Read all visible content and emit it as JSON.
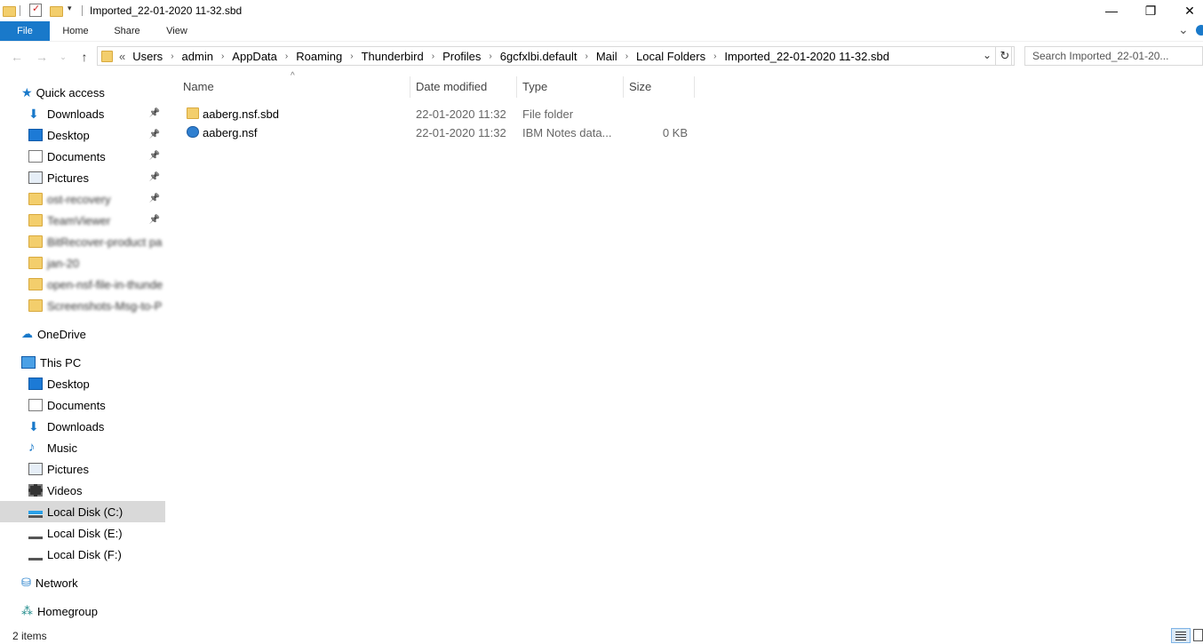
{
  "window": {
    "title": "Imported_22-01-2020 11-32.sbd",
    "minimize_glyph": "—",
    "restore_glyph": "❐",
    "close_glyph": "✕"
  },
  "ribbon": {
    "tabs": [
      "File",
      "Home",
      "Share",
      "View"
    ],
    "expand_glyph": "⌄"
  },
  "address": {
    "overflow": "«",
    "crumbs": [
      "Users",
      "admin",
      "AppData",
      "Roaming",
      "Thunderbird",
      "Profiles",
      "6gcfxlbi.default",
      "Mail",
      "Local Folders",
      "Imported_22-01-2020 11-32.sbd"
    ],
    "separator": "›",
    "search_placeholder": "Search Imported_22-01-20..."
  },
  "nav": {
    "quick_access": "Quick access",
    "quick_items": [
      {
        "label": "Downloads",
        "icon": "download-icon",
        "pinned": true
      },
      {
        "label": "Desktop",
        "icon": "desktop-icon",
        "pinned": true
      },
      {
        "label": "Documents",
        "icon": "documents-icon",
        "pinned": true
      },
      {
        "label": "Pictures",
        "icon": "pictures-icon",
        "pinned": true
      },
      {
        "label": "ost-recovery",
        "icon": "folder-icon",
        "pinned": true,
        "blurred": true
      },
      {
        "label": "TeamViewer",
        "icon": "folder-icon",
        "pinned": true,
        "blurred": true
      },
      {
        "label": "BitRecover-product pa",
        "icon": "folder-icon",
        "pinned": false,
        "blurred": true
      },
      {
        "label": "jan-20",
        "icon": "folder-icon",
        "pinned": false,
        "blurred": true
      },
      {
        "label": "open-nsf-file-in-thunde",
        "icon": "folder-icon",
        "pinned": false,
        "blurred": true
      },
      {
        "label": "Screenshots-Msg-to-P",
        "icon": "folder-icon",
        "pinned": false,
        "blurred": true
      }
    ],
    "onedrive": "OneDrive",
    "this_pc": "This PC",
    "pc_items": [
      {
        "label": "Desktop",
        "icon": "desktop-icon"
      },
      {
        "label": "Documents",
        "icon": "documents-icon"
      },
      {
        "label": "Downloads",
        "icon": "download-icon"
      },
      {
        "label": "Music",
        "icon": "music-icon"
      },
      {
        "label": "Pictures",
        "icon": "pictures-icon"
      },
      {
        "label": "Videos",
        "icon": "videos-icon"
      },
      {
        "label": "Local Disk (C:)",
        "icon": "drive-c-icon",
        "selected": true
      },
      {
        "label": "Local Disk (E:)",
        "icon": "drive-icon"
      },
      {
        "label": "Local Disk (F:)",
        "icon": "drive-icon"
      }
    ],
    "network": "Network",
    "homegroup": "Homegroup"
  },
  "table": {
    "columns": [
      "Name",
      "Date modified",
      "Type",
      "Size"
    ],
    "sort_glyph": "^",
    "rows": [
      {
        "name": "aaberg.nsf.sbd",
        "date": "22-01-2020 11:32",
        "type": "File folder",
        "size": "",
        "icon": "folder-icon"
      },
      {
        "name": "aaberg.nsf",
        "date": "22-01-2020 11:32",
        "type": "IBM Notes data...",
        "size": "0 KB",
        "icon": "ibm-notes-icon"
      }
    ]
  },
  "status": {
    "count": "2 items"
  },
  "colors": {
    "accent": "#1979ca",
    "selected": "#d9d9d9",
    "folder": "#f3ce6c"
  }
}
